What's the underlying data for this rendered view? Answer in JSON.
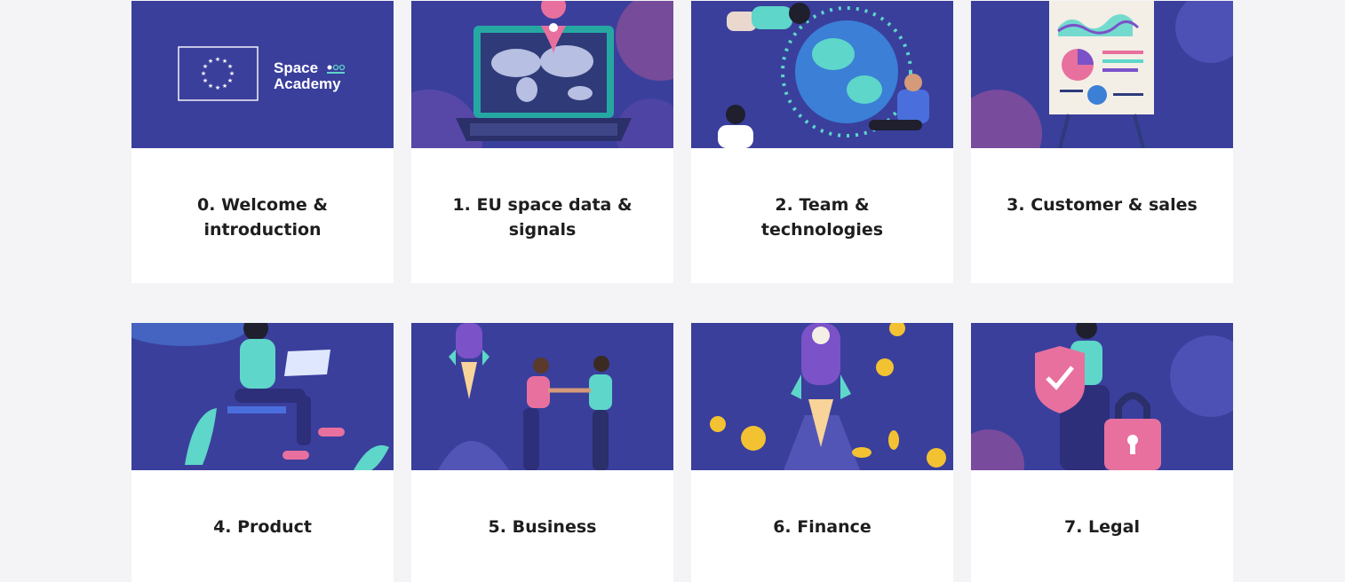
{
  "cards": [
    {
      "title": "0. Welcome & introduction",
      "image": "eu-space-academy-logo"
    },
    {
      "title": "1. EU space data & signals",
      "image": "laptop-world-map"
    },
    {
      "title": "2. Team & technologies",
      "image": "people-around-globe"
    },
    {
      "title": "3. Customer & sales",
      "image": "presentation-board-charts"
    },
    {
      "title": "4. Product",
      "image": "woman-with-laptop"
    },
    {
      "title": "5. Business",
      "image": "handshake-rocket"
    },
    {
      "title": "6. Finance",
      "image": "rocket-coins"
    },
    {
      "title": "7. Legal",
      "image": "shield-padlock"
    }
  ],
  "logo": {
    "line1": "Space",
    "line2": "Academy"
  },
  "colors": {
    "banner": "#3a3f9c",
    "accent_teal": "#5ed6c9",
    "accent_pink": "#e8709e",
    "background": "#f4f4f7"
  }
}
